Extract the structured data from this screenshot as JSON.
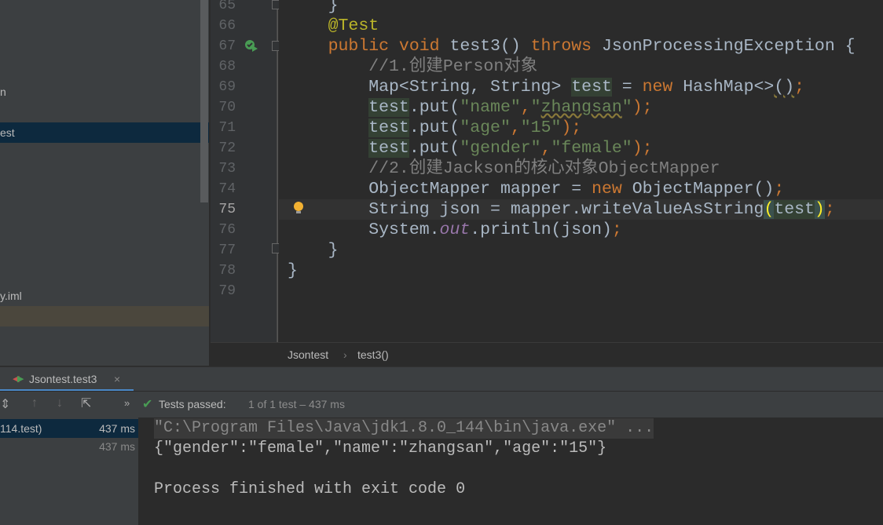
{
  "sidebar": {
    "items": [
      {
        "label": "n"
      },
      {
        "label": "est"
      },
      {
        "label": "y.iml"
      }
    ]
  },
  "gutter": {
    "line_numbers": [
      "65",
      "66",
      "67",
      "68",
      "69",
      "70",
      "71",
      "72",
      "73",
      "74",
      "75",
      "76",
      "77",
      "78",
      "79"
    ]
  },
  "code": {
    "lines": [
      [
        {
          "t": "    }",
          "c": ""
        }
      ],
      [
        {
          "t": "    ",
          "c": ""
        },
        {
          "t": "@Test",
          "c": "ann"
        }
      ],
      [
        {
          "t": "    ",
          "c": ""
        },
        {
          "t": "public void ",
          "c": "kw"
        },
        {
          "t": "test3() ",
          "c": ""
        },
        {
          "t": "throws ",
          "c": "kw"
        },
        {
          "t": "JsonProcessingException {",
          "c": ""
        }
      ],
      [
        {
          "t": "        //1.创建Person对象",
          "c": "cm"
        }
      ],
      [
        {
          "t": "        Map<String, String> ",
          "c": ""
        },
        {
          "t": "test",
          "c": "hl"
        },
        {
          "t": " = ",
          "c": ""
        },
        {
          "t": "new ",
          "c": "kw"
        },
        {
          "t": "HashMap<>",
          "c": ""
        },
        {
          "t": "()",
          "c": "wv"
        },
        {
          "t": ";",
          "c": "kw"
        }
      ],
      [
        {
          "t": "        ",
          "c": ""
        },
        {
          "t": "test",
          "c": "hl"
        },
        {
          "t": ".put(",
          "c": ""
        },
        {
          "t": "\"name\"",
          "c": "str"
        },
        {
          "t": ",",
          "c": "kw"
        },
        {
          "t": "\"",
          "c": "str"
        },
        {
          "t": "zhangsan",
          "c": "str wv"
        },
        {
          "t": "\"",
          "c": "str"
        },
        {
          "t": ");",
          "c": "kw"
        }
      ],
      [
        {
          "t": "        ",
          "c": ""
        },
        {
          "t": "test",
          "c": "hl"
        },
        {
          "t": ".put(",
          "c": ""
        },
        {
          "t": "\"age\"",
          "c": "str"
        },
        {
          "t": ",",
          "c": "kw"
        },
        {
          "t": "\"15\"",
          "c": "str"
        },
        {
          "t": ");",
          "c": "kw"
        }
      ],
      [
        {
          "t": "        ",
          "c": ""
        },
        {
          "t": "test",
          "c": "hl"
        },
        {
          "t": ".put(",
          "c": ""
        },
        {
          "t": "\"gender\"",
          "c": "str"
        },
        {
          "t": ",",
          "c": "kw"
        },
        {
          "t": "\"female\"",
          "c": "str"
        },
        {
          "t": ");",
          "c": "kw"
        }
      ],
      [
        {
          "t": "        //2.创建Jackson的核心对象ObjectMapper",
          "c": "cm"
        }
      ],
      [
        {
          "t": "        ObjectMapper mapper = ",
          "c": ""
        },
        {
          "t": "new ",
          "c": "kw"
        },
        {
          "t": "ObjectMapper()",
          "c": ""
        },
        {
          "t": ";",
          "c": "kw"
        }
      ],
      [
        {
          "t": "        String json = mapper.writeValueAsString",
          "c": ""
        },
        {
          "t": "(",
          "c": "br"
        },
        {
          "t": "test",
          "c": "hl"
        },
        {
          "t": ")",
          "c": "br"
        },
        {
          "t": ";",
          "c": "kw"
        }
      ],
      [
        {
          "t": "        System.",
          "c": ""
        },
        {
          "t": "out",
          "c": "st"
        },
        {
          "t": ".println(json)",
          "c": ""
        },
        {
          "t": ";",
          "c": "kw"
        }
      ],
      [
        {
          "t": "    }",
          "c": ""
        }
      ],
      [
        {
          "t": "}",
          "c": ""
        }
      ],
      [
        {
          "t": "",
          "c": ""
        }
      ]
    ]
  },
  "breadcrumb": {
    "class": "Jsontest",
    "method": "test3()"
  },
  "run_tab": {
    "label": "Jsontest.test3"
  },
  "status": {
    "passed_label": "Tests passed:",
    "detail": "1 of 1 test – 437 ms"
  },
  "tree": {
    "rows": [
      {
        "label": "114.test)",
        "time": "437 ms"
      },
      {
        "label": "",
        "time": "437 ms"
      }
    ]
  },
  "console": {
    "lines": [
      "\"C:\\Program Files\\Java\\jdk1.8.0_144\\bin\\java.exe\" ...",
      "{\"gender\":\"female\",\"name\":\"zhangsan\",\"age\":\"15\"}",
      "",
      "Process finished with exit code 0"
    ]
  },
  "colors": {
    "keyword": "#cc7832",
    "string": "#6a8759",
    "annotation": "#bbb529",
    "comment": "#808080",
    "pass": "#499c54"
  }
}
